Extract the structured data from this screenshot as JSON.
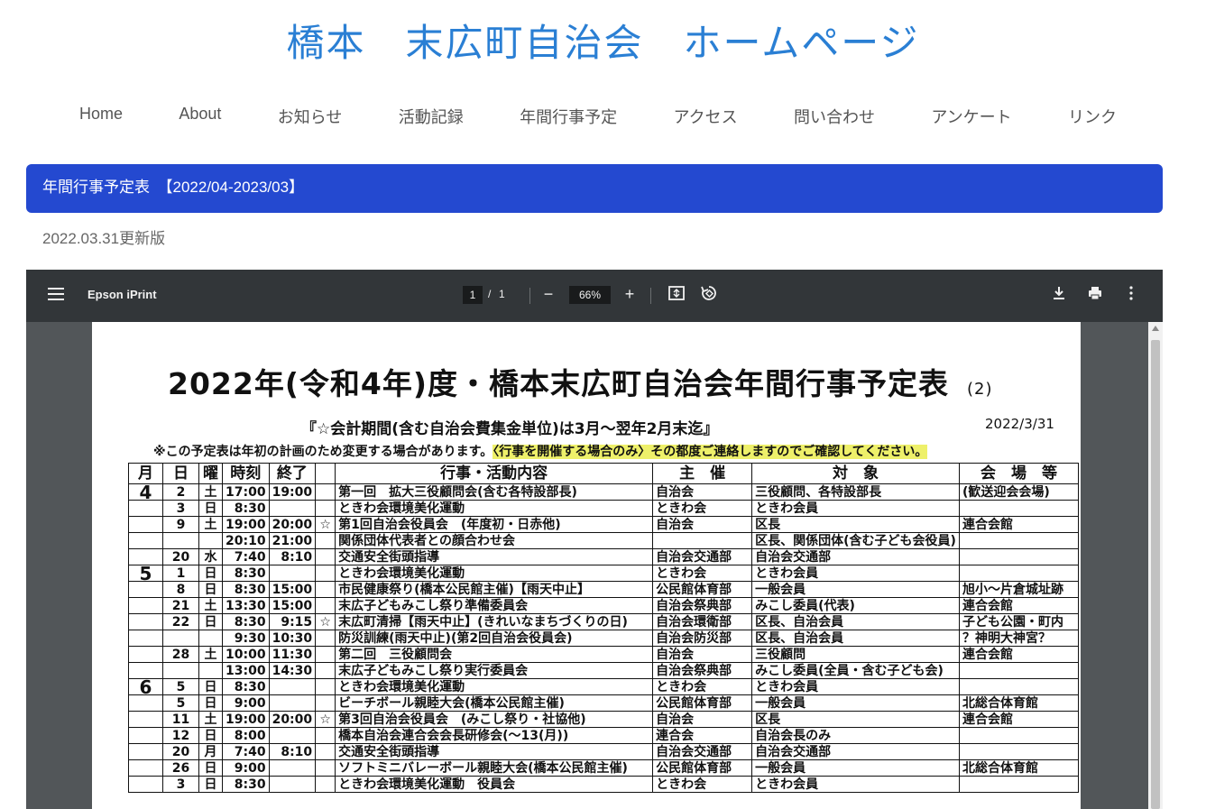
{
  "site": {
    "title": "橋本　末広町自治会　ホームページ"
  },
  "nav": [
    "Home",
    "About",
    "お知らせ",
    "活動記録",
    "年間行事予定",
    "アクセス",
    "問い合わせ",
    "アンケート",
    "リンク"
  ],
  "banner": "年間行事予定表　【2022/04-2023/03】",
  "updated": "2022.03.31更新版",
  "viewer": {
    "filename": "Epson iPrint",
    "page_current": "1",
    "page_sep": "/",
    "page_total": "1",
    "zoom": "66%",
    "icons": [
      "menu-icon",
      "minus-icon",
      "plus-icon",
      "fit-page-icon",
      "rotate-icon",
      "download-icon",
      "print-icon",
      "more-icon"
    ]
  },
  "doc": {
    "title": "2022年(令和4年)度・橋本末広町自治会年間行事予定表",
    "title_num": "(2)",
    "subtitle": "『☆会計期間(含む自治会費集金単位)は3月～翌年2月末迄』",
    "date": "2022/3/31",
    "note": "※この予定表は年初の計画のため変更する場合があります。",
    "note_hl": "〈行事を開催する場合のみ〉その都度ご連絡しますのでご確認してください。",
    "headers": [
      "月",
      "日",
      "曜",
      "時刻",
      "終了",
      "",
      "行事・活動内容",
      "主　催",
      "対　象",
      "会　場　等"
    ],
    "rows": [
      [
        "4",
        "2",
        "土",
        "17:00",
        "19:00",
        "",
        "第一回　拡大三役顧問会(含む各特設部長)",
        "自治会",
        "三役顧問、各特設部長",
        "(歓送迎会会場)"
      ],
      [
        "",
        "3",
        "日",
        "8:30",
        "",
        "",
        "ときわ会環境美化運動",
        "ときわ会",
        "ときわ会員",
        ""
      ],
      [
        "",
        "9",
        "土",
        "19:00",
        "20:00",
        "☆",
        "第1回自治会役員会　(年度初・日赤他)",
        "自治会",
        "区長",
        "連合会館"
      ],
      [
        "",
        "",
        "",
        "20:10",
        "21:00",
        "",
        "関係団体代表者との顔合わせ会",
        "",
        "区長、関係団体(含む子ども会役員)",
        ""
      ],
      [
        "",
        "20",
        "水",
        "7:40",
        "8:10",
        "",
        "交通安全街頭指導",
        "自治会交通部",
        "自治会交通部",
        ""
      ],
      [
        "5",
        "1",
        "日",
        "8:30",
        "",
        "",
        "ときわ会環境美化運動",
        "ときわ会",
        "ときわ会員",
        ""
      ],
      [
        "",
        "8",
        "日",
        "8:30",
        "15:00",
        "",
        "市民健康祭り(橋本公民館主催)【雨天中止】",
        "公民館体育部",
        "一般会員",
        "旭小～片倉城址跡"
      ],
      [
        "",
        "21",
        "土",
        "13:30",
        "15:00",
        "",
        "末広子どもみこし祭り準備委員会",
        "自治会祭典部",
        "みこし委員(代表)",
        "連合会館"
      ],
      [
        "",
        "22",
        "日",
        "8:30",
        "9:15",
        "☆",
        "末広町清掃【雨天中止】(きれいなまちづくりの日)",
        "自治会環衛部",
        "区長、自治会員",
        "子ども公園・町内"
      ],
      [
        "",
        "",
        "",
        "9:30",
        "10:30",
        "",
        "防災訓練(雨天中止)(第2回自治会役員会)",
        "自治会防災部",
        "区長、自治会員",
        "？神明大神宮？"
      ],
      [
        "",
        "28",
        "土",
        "10:00",
        "11:30",
        "",
        "第二回　三役顧問会",
        "自治会",
        "三役顧問",
        "連合会館"
      ],
      [
        "",
        "",
        "",
        "13:00",
        "14:30",
        "",
        "末広子どもみこし祭り実行委員会",
        "自治会祭典部",
        "みこし委員(全員・含む子ども会)",
        ""
      ],
      [
        "6",
        "5",
        "日",
        "8:30",
        "",
        "",
        "ときわ会環境美化運動",
        "ときわ会",
        "ときわ会員",
        ""
      ],
      [
        "",
        "5",
        "日",
        "9:00",
        "",
        "",
        "ビーチボール親睦大会(橋本公民館主催)",
        "公民館体育部",
        "一般会員",
        "北総合体育館"
      ],
      [
        "",
        "11",
        "土",
        "19:00",
        "20:00",
        "☆",
        "第3回自治会役員会　(みこし祭り・社協他)",
        "自治会",
        "区長",
        "連合会館"
      ],
      [
        "",
        "12",
        "日",
        "8:00",
        "",
        "",
        "橋本自治会連合会会長研修会(～13(月))",
        "連合会",
        "自治会長のみ",
        ""
      ],
      [
        "",
        "20",
        "月",
        "7:40",
        "8:10",
        "",
        "交通安全街頭指導",
        "自治会交通部",
        "自治会交通部",
        ""
      ],
      [
        "",
        "26",
        "日",
        "9:00",
        "",
        "",
        "ソフトミニバレーボール親睦大会(橋本公民館主催)",
        "公民館体育部",
        "一般会員",
        "北総合体育館"
      ],
      [
        "",
        "3",
        "日",
        "8:30",
        "",
        "",
        "ときわ会環境美化運動　役員会",
        "ときわ会",
        "ときわ会員",
        ""
      ]
    ]
  }
}
